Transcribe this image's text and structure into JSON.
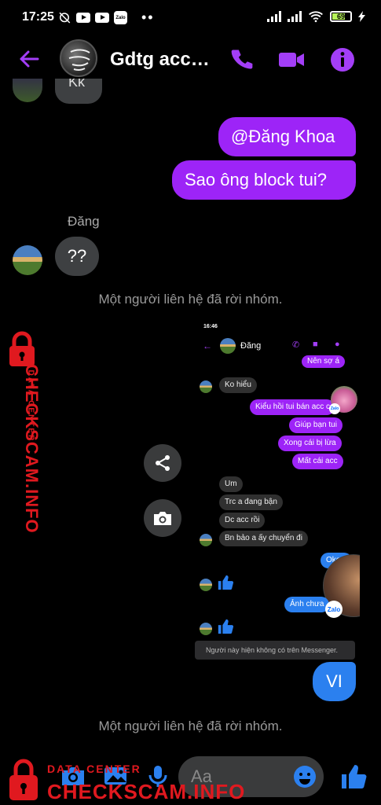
{
  "status_bar": {
    "time": "17:25",
    "zalo_label": "Zalo",
    "battery": "69"
  },
  "header": {
    "title": "Gdtg acc…",
    "icons": [
      "back-arrow-icon",
      "phone-icon",
      "video-camera-icon",
      "info-icon"
    ]
  },
  "colors": {
    "accent": "#a33ef7",
    "my_bubble": "#9d24f7",
    "their_bubble": "#3e4042",
    "blue_bubble": "#2b80ef",
    "watermark": "#e0191f"
  },
  "messages": {
    "partial_text": "Kk",
    "mine_1": "@Đăng Khoa",
    "mine_2": "Sao ông block tui?",
    "sender_name": "Đăng",
    "theirs_1": "??",
    "system_1": "Một người liên hệ đã rời nhóm.",
    "vi": "VI",
    "system_2": "Một người liên hệ đã rời nhóm."
  },
  "nested_screenshot": {
    "time": "16:46",
    "title": "Đăng",
    "messages": [
      {
        "side": "mine",
        "text": "Nên sợ á"
      },
      {
        "side": "theirs",
        "text": "Ko hiểu"
      },
      {
        "side": "mine",
        "text": "Kiểu hồi tui bán acc c"
      },
      {
        "side": "mine",
        "text": "Giúp bạn tui"
      },
      {
        "side": "mine",
        "text": "Xong cái bị lừa"
      },
      {
        "side": "mine",
        "text": "Mất cái acc"
      },
      {
        "side": "theirs",
        "text": "Um"
      },
      {
        "side": "theirs",
        "text": "Trc a đang bận"
      },
      {
        "side": "theirs",
        "text": "Dc acc rồi"
      },
      {
        "side": "theirs",
        "text": "Bn bảo a ấy chuyển đi"
      },
      {
        "side": "mine-blue",
        "text": "Oke"
      },
      {
        "side": "mine-blue",
        "text": "Ảnh chưa"
      }
    ],
    "zalo_chip": "Zalo",
    "note": "Người này hiện không có trên Messenger."
  },
  "composer": {
    "placeholder": "Aa",
    "icons": [
      "camera-icon",
      "image-icon",
      "microphone-icon",
      "emoji-icon",
      "thumbs-up-icon"
    ]
  },
  "watermark": {
    "small": "DATA CENTER",
    "big": "CHECKSCAM.INFO"
  }
}
